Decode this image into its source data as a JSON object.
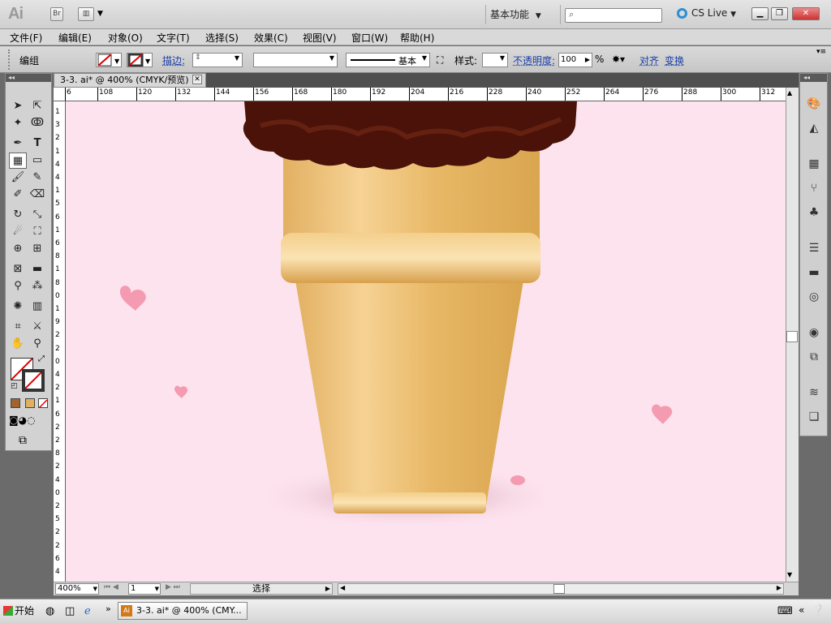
{
  "app": {
    "logo": "Ai",
    "bridge_label": "Br",
    "workspace": "基本功能",
    "cslive": "CS Live"
  },
  "menu": [
    "文件(F)",
    "编辑(E)",
    "对象(O)",
    "文字(T)",
    "选择(S)",
    "效果(C)",
    "视图(V)",
    "窗口(W)",
    "帮助(H)"
  ],
  "control": {
    "selection_type": "编组",
    "stroke_label": "描边:",
    "stroke_profile": "基本",
    "style_label": "样式:",
    "opacity_label": "不透明度:",
    "opacity_value": "100",
    "opacity_unit": "%",
    "align_label": "对齐",
    "transform_label": "变换"
  },
  "document": {
    "tab_title": "3-3. ai* @ 400% (CMYK/预览)",
    "zoom": "400%",
    "artboard": "1",
    "status_text": "选择"
  },
  "ruler": {
    "h": [
      "6",
      "108",
      "120",
      "132",
      "144",
      "156",
      "168",
      "180",
      "192",
      "204",
      "216",
      "228",
      "240",
      "252",
      "264",
      "276",
      "288",
      "300",
      "312"
    ],
    "v": [
      "1",
      "3",
      "2",
      "1",
      "4",
      "4",
      "1",
      "5",
      "6",
      "1",
      "6",
      "8",
      "1",
      "8",
      "0",
      "1",
      "9",
      "2",
      "2",
      "0",
      "4",
      "2",
      "1",
      "6",
      "2",
      "2",
      "8",
      "2",
      "4",
      "0",
      "2",
      "5",
      "2",
      "2",
      "6",
      "4"
    ]
  },
  "taskbar": {
    "start": "开始",
    "item": "3-3. ai* @ 400% (CMY..."
  },
  "colors": {
    "canvas_bg": "#fde3ee",
    "chocolate": "#4a1208",
    "cone": "#e8b866",
    "heart": "#f49bb1"
  }
}
